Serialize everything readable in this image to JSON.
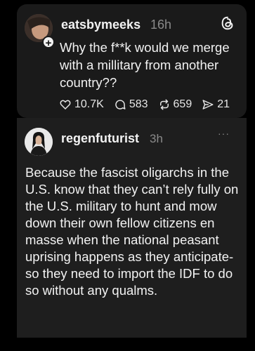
{
  "quoted_post": {
    "username": "eatsbymeeks",
    "time": "16h",
    "follow_symbol": "+",
    "text": "Why the f**k would we merge with a millitary from another country??",
    "likes": "10.7K",
    "replies": "583",
    "reposts": "659",
    "shares": "21"
  },
  "reply_post": {
    "username": "regenfuturist",
    "time": "3h",
    "more_label": "···",
    "text": "Because the fascist oligarchs in the U.S. know that they can’t rely fully on the U.S. military to hunt and mow down their own fellow citizens en masse when the national peasant uprising happens as they anticipate- so they need to import the IDF to do so without any qualms."
  },
  "icons": {
    "like": "heart-icon",
    "reply": "comment-icon",
    "repost": "repost-icon",
    "share": "send-icon",
    "brand": "threads-logo-icon"
  },
  "colors": {
    "background": "#000000",
    "card": "#1a1a1a",
    "text": "#f2f2f2",
    "muted": "#8a8a8a"
  }
}
